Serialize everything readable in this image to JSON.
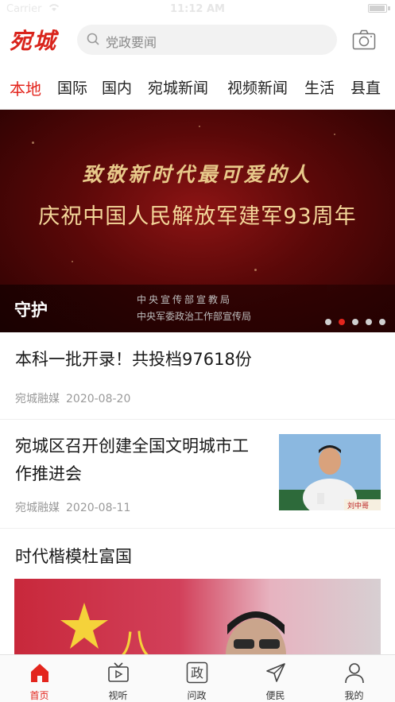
{
  "status_bar": {
    "carrier": "Carrier",
    "time": "11:12 AM"
  },
  "header": {
    "logo": "宛城",
    "search_placeholder": "党政要闻"
  },
  "tabs": [
    {
      "label": "本地",
      "active": true
    },
    {
      "label": "国际"
    },
    {
      "label": "国内"
    },
    {
      "label": "宛城新闻"
    },
    {
      "label": "视频新闻"
    },
    {
      "label": "生活"
    },
    {
      "label": "县直"
    }
  ],
  "banner": {
    "line1": "致敬新时代最可爱的人",
    "line2": "庆祝中国人民解放军建军93周年",
    "caption_title": "守护",
    "caption_org1": "中央宣传部宣教局",
    "caption_org2": "中央军委政治工作部宣传局",
    "slide_count": 5,
    "active_slide": 2
  },
  "news": [
    {
      "title": "本科一批开录！共投档97618份",
      "source": "宛城融媒",
      "date": "2020-08-20"
    },
    {
      "title_line1": "宛城区召开创建全国文明城市工",
      "title_line2": "作推进会",
      "source": "宛城融媒",
      "date": "2020-08-11",
      "thumb_nameplate": "刘中哥"
    },
    {
      "title": "时代楷模杜富国"
    }
  ],
  "tabbar": [
    {
      "label": "首页",
      "icon": "home-icon",
      "active": true
    },
    {
      "label": "视听",
      "icon": "tv-icon"
    },
    {
      "label": "问政",
      "icon": "zheng-icon",
      "glyph": "政"
    },
    {
      "label": "便民",
      "icon": "send-icon"
    },
    {
      "label": "我的",
      "icon": "user-icon"
    }
  ],
  "colors": {
    "accent": "#e3251d",
    "logo": "#d9241c"
  }
}
